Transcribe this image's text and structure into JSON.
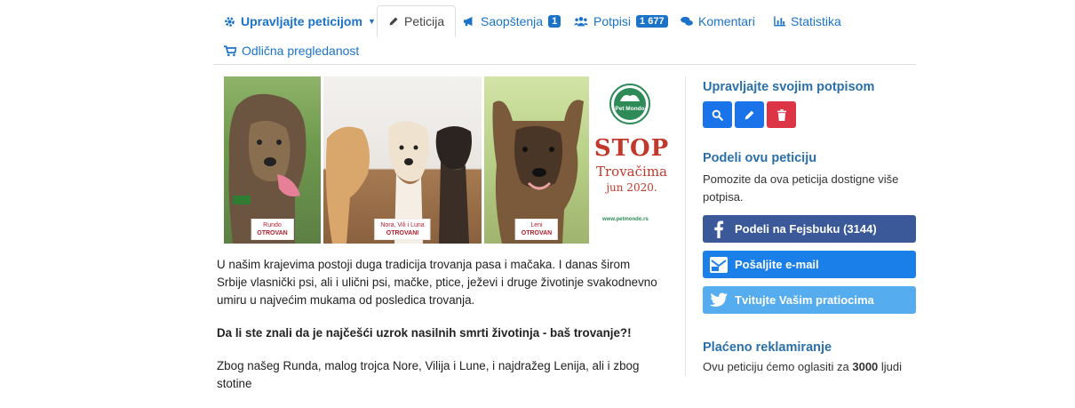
{
  "nav": {
    "manage": "Upravljajte peticijom",
    "petition": "Peticija",
    "announcements": "Saopštenja",
    "announcements_count": "1",
    "signatures": "Potpisi",
    "signatures_count": "1 677",
    "comments": "Komentari",
    "stats": "Statistika",
    "promote": "Odlična pregledanost"
  },
  "banner": {
    "dogs": [
      {
        "name": "Rundo",
        "status": "OTROVAN"
      },
      {
        "name": "Nora, Vili i Luna",
        "status": "OTROVANI"
      },
      {
        "name": "Leni",
        "status": "OTROVAN"
      }
    ],
    "logo_text": "Pet Mondo",
    "stop": "STOP",
    "headline": "Trovačima",
    "date": "jun 2020.",
    "site": "www.petmondo.rs"
  },
  "content": {
    "p1": "U našim krajevima postoji duga tradicija trovanja pasa i mačaka. I danas širom Srbije vlasnički psi, ali i ulični psi, mačke, ptice, ježevi i druge životinje svakodnevno umiru u najvećim mukama od posledica trovanja.",
    "p2": "Da li ste znali da je najčešći uzrok nasilnih smrti životinja - baš trovanje?!",
    "p3": "Zbog našeg Runda, malog trojca Nore, Vilija i Lune, i najdražeg Lenija, ali i zbog stotine"
  },
  "sidebar": {
    "manage_title": "Upravljajte svojim potpisom",
    "share_title": "Podeli ovu peticiju",
    "share_text": "Pomozite da ova peticija dostigne više potpisa.",
    "facebook": "Podeli na Fejsbuku (3144)",
    "email": "Pošaljite e-mail",
    "twitter": "Tvitujte Vašim pratiocima",
    "ads_title": "Plaćeno reklamiranje",
    "ads_text_a": "Ovu peticiju ćemo oglasiti za ",
    "ads_amount": "3000",
    "ads_text_b": " ljudi"
  },
  "colors": {
    "link": "#1a73c8",
    "facebook": "#3b5998",
    "email": "#1a7fe8",
    "twitter": "#55acee",
    "delete": "#dc3545"
  }
}
